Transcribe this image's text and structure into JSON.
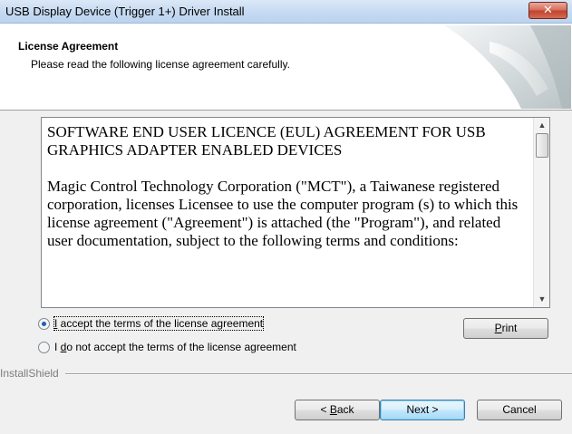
{
  "window": {
    "title": "USB Display Device (Trigger 1+) Driver Install",
    "close_glyph": "✕"
  },
  "header": {
    "title": "License Agreement",
    "subtitle": "Please read the following license agreement carefully."
  },
  "license": {
    "paragraphs": [
      "SOFTWARE END USER LICENCE (EUL) AGREEMENT FOR USB GRAPHICS ADAPTER ENABLED DEVICES",
      "Magic Control Technology Corporation (\"MCT\"), a Taiwanese registered corporation, licenses Licensee to use the computer program (s) to which this license agreement (\"Agreement\") is attached (the \"Program\"), and related user documentation, subject to the following terms and conditions:"
    ],
    "scroll_up_glyph": "▲",
    "scroll_down_glyph": "▼"
  },
  "options": {
    "accept": {
      "label_mnemonic": "I",
      "label_rest": " accept the terms of the license agreement",
      "checked": true
    },
    "decline": {
      "label_pre": "I ",
      "label_mnemonic": "d",
      "label_rest": "o not accept the terms of the license agreement",
      "checked": false
    }
  },
  "buttons": {
    "print": {
      "mnemonic": "P",
      "rest": "rint"
    },
    "back": {
      "pre": "< ",
      "mnemonic": "B",
      "rest": "ack"
    },
    "next": {
      "label": "Next >"
    },
    "cancel": {
      "label": "Cancel"
    }
  },
  "footer": {
    "brand": "InstallShield"
  },
  "colors": {
    "default_button": "#bee6fd",
    "title_bar": "#c4d9f1",
    "close_button": "#c0452f"
  }
}
